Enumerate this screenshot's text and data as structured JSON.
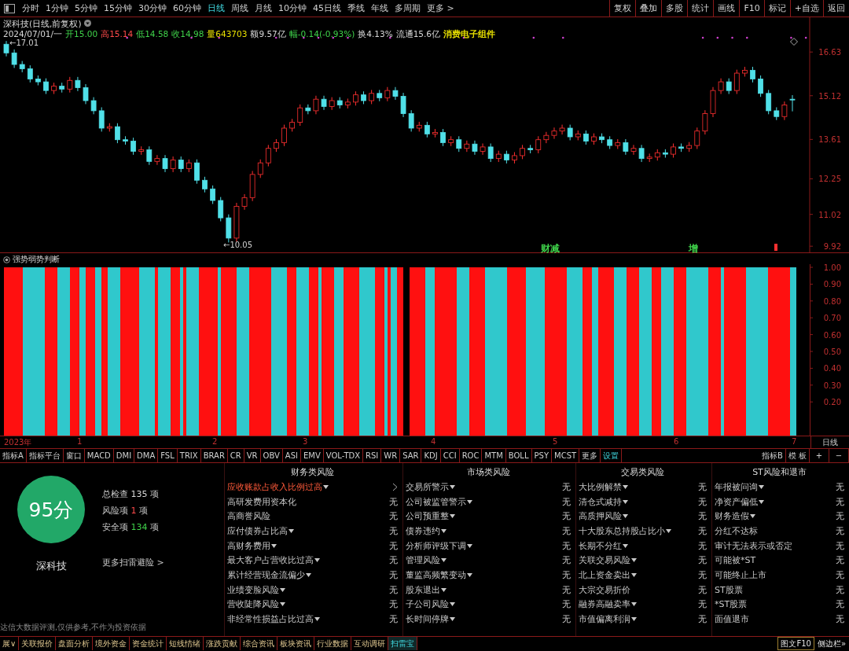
{
  "toolbar": {
    "periods": [
      {
        "label": "分时",
        "selected": false
      },
      {
        "label": "1分钟",
        "selected": false
      },
      {
        "label": "5分钟",
        "selected": false
      },
      {
        "label": "15分钟",
        "selected": false
      },
      {
        "label": "30分钟",
        "selected": false
      },
      {
        "label": "60分钟",
        "selected": false
      },
      {
        "label": "日线",
        "selected": true
      },
      {
        "label": "周线",
        "selected": false
      },
      {
        "label": "月线",
        "selected": false
      },
      {
        "label": "10分钟",
        "selected": false
      },
      {
        "label": "45日线",
        "selected": false
      },
      {
        "label": "季线",
        "selected": false
      },
      {
        "label": "年线",
        "selected": false
      },
      {
        "label": "多周期",
        "selected": false
      },
      {
        "label": "更多 >",
        "selected": false
      }
    ],
    "actions": [
      "复权",
      "叠加",
      "多股",
      "统计",
      "画线",
      "F10",
      "标记",
      "+自选",
      "返回"
    ]
  },
  "chart": {
    "title": "深科技(日线,前复权)",
    "quote": [
      {
        "text": "2024/07/01/一",
        "color": "#d8d8d8"
      },
      {
        "text": "开15.00",
        "color": "#3fd24a"
      },
      {
        "text": "高15.14",
        "color": "#ff4a4a"
      },
      {
        "text": "低14.58",
        "color": "#3fd24a"
      },
      {
        "text": "收14.98",
        "color": "#3fd24a"
      },
      {
        "text": "量643703",
        "color": "#e8e000"
      },
      {
        "text": "额9.57亿",
        "color": "#d8d8d8"
      },
      {
        "text": "幅-0.14(-0.93%)",
        "color": "#3fd24a"
      },
      {
        "text": "换4.13%",
        "color": "#d8d8d8"
      },
      {
        "text": "流通15.6亿",
        "color": "#d8d8d8"
      },
      {
        "text": "消费电子组件",
        "color": "#e8e000"
      }
    ],
    "high_label": "←17.01",
    "low_label": "←10.05",
    "chart_data": {
      "type": "candlestick",
      "ylim": [
        9.68,
        17.83
      ],
      "yticks": [
        16.63,
        15.12,
        13.61,
        12.25,
        11.02,
        9.92
      ],
      "ohlc": [
        [
          16.9,
          17.01,
          16.48,
          16.6
        ],
        [
          16.6,
          16.72,
          16.08,
          16.2
        ],
        [
          16.2,
          16.32,
          15.93,
          16.05
        ],
        [
          16.05,
          16.17,
          15.58,
          15.7
        ],
        [
          15.7,
          15.82,
          15.48,
          15.6
        ],
        [
          15.6,
          15.72,
          15.18,
          15.3
        ],
        [
          15.3,
          15.57,
          15.18,
          15.45
        ],
        [
          15.45,
          15.57,
          15.23,
          15.35
        ],
        [
          15.35,
          15.77,
          15.23,
          15.65
        ],
        [
          15.65,
          15.77,
          15.28,
          15.4
        ],
        [
          15.4,
          15.52,
          14.83,
          14.95
        ],
        [
          14.95,
          15.07,
          14.48,
          14.6
        ],
        [
          14.6,
          14.72,
          13.88,
          14.0
        ],
        [
          14.0,
          14.17,
          13.88,
          14.05
        ],
        [
          14.05,
          14.17,
          13.48,
          13.6
        ],
        [
          13.6,
          13.72,
          13.43,
          13.55
        ],
        [
          13.55,
          13.67,
          13.08,
          13.2
        ],
        [
          13.2,
          13.37,
          13.08,
          13.25
        ],
        [
          13.25,
          13.37,
          12.73,
          12.85
        ],
        [
          12.85,
          13.07,
          12.73,
          12.95
        ],
        [
          12.95,
          13.07,
          12.48,
          12.6
        ],
        [
          12.6,
          13.02,
          12.48,
          12.9
        ],
        [
          12.9,
          13.02,
          12.48,
          12.6
        ],
        [
          12.6,
          12.92,
          12.48,
          12.8
        ],
        [
          12.8,
          12.92,
          12.08,
          12.2
        ],
        [
          12.2,
          12.32,
          11.78,
          11.9
        ],
        [
          11.9,
          12.02,
          11.38,
          11.5
        ],
        [
          11.5,
          11.62,
          10.78,
          10.9
        ],
        [
          10.9,
          11.02,
          10.05,
          10.2
        ],
        [
          10.2,
          11.42,
          10.08,
          11.3
        ],
        [
          11.3,
          11.72,
          11.18,
          11.6
        ],
        [
          11.6,
          12.52,
          11.48,
          12.4
        ],
        [
          12.4,
          12.92,
          12.28,
          12.8
        ],
        [
          12.8,
          13.42,
          12.68,
          13.3
        ],
        [
          13.3,
          13.62,
          13.18,
          13.5
        ],
        [
          13.5,
          14.12,
          13.38,
          14.0
        ],
        [
          14.0,
          14.32,
          13.88,
          14.2
        ],
        [
          14.2,
          14.82,
          14.08,
          14.7
        ],
        [
          14.7,
          14.82,
          14.48,
          14.6
        ],
        [
          14.6,
          15.12,
          14.48,
          15.0
        ],
        [
          15.0,
          15.12,
          14.63,
          14.75
        ],
        [
          14.75,
          15.07,
          14.63,
          14.95
        ],
        [
          14.95,
          15.07,
          14.68,
          14.8
        ],
        [
          14.8,
          15.02,
          14.68,
          14.9
        ],
        [
          14.9,
          15.27,
          14.78,
          15.15
        ],
        [
          15.15,
          15.27,
          14.83,
          14.95
        ],
        [
          14.95,
          15.32,
          14.83,
          15.2
        ],
        [
          15.2,
          15.32,
          14.93,
          15.05
        ],
        [
          15.05,
          15.42,
          14.93,
          15.3
        ],
        [
          15.3,
          15.42,
          14.98,
          15.1
        ],
        [
          15.1,
          15.22,
          14.38,
          14.5
        ],
        [
          14.5,
          14.62,
          13.88,
          14.0
        ],
        [
          14.0,
          14.22,
          13.88,
          14.1
        ],
        [
          14.1,
          14.22,
          13.68,
          13.8
        ],
        [
          13.8,
          13.97,
          13.68,
          13.85
        ],
        [
          13.85,
          13.97,
          13.38,
          13.5
        ],
        [
          13.5,
          13.72,
          13.38,
          13.6
        ],
        [
          13.6,
          13.72,
          13.18,
          13.3
        ],
        [
          13.3,
          13.57,
          13.18,
          13.45
        ],
        [
          13.45,
          13.57,
          13.08,
          13.2
        ],
        [
          13.2,
          13.47,
          13.08,
          13.35
        ],
        [
          13.35,
          13.47,
          12.83,
          12.95
        ],
        [
          12.95,
          13.22,
          12.83,
          13.1
        ],
        [
          13.1,
          13.22,
          12.78,
          12.9
        ],
        [
          12.9,
          13.17,
          12.78,
          13.05
        ],
        [
          13.05,
          13.42,
          12.93,
          13.3
        ],
        [
          13.3,
          13.42,
          13.13,
          13.25
        ],
        [
          13.25,
          13.72,
          13.13,
          13.6
        ],
        [
          13.6,
          13.87,
          13.48,
          13.75
        ],
        [
          13.75,
          14.02,
          13.63,
          13.9
        ],
        [
          13.9,
          14.12,
          13.78,
          14.0
        ],
        [
          14.0,
          14.12,
          13.58,
          13.7
        ],
        [
          13.7,
          13.92,
          13.58,
          13.8
        ],
        [
          13.8,
          13.92,
          13.43,
          13.55
        ],
        [
          13.55,
          13.82,
          13.43,
          13.7
        ],
        [
          13.7,
          13.82,
          13.48,
          13.6
        ],
        [
          13.6,
          13.72,
          13.28,
          13.4
        ],
        [
          13.4,
          13.62,
          13.28,
          13.5
        ],
        [
          13.5,
          13.62,
          13.08,
          13.2
        ],
        [
          13.2,
          13.42,
          13.08,
          13.3
        ],
        [
          13.3,
          13.42,
          12.83,
          12.95
        ],
        [
          12.95,
          13.12,
          12.83,
          13.0
        ],
        [
          13.0,
          13.27,
          12.88,
          13.15
        ],
        [
          13.15,
          13.27,
          12.98,
          13.1
        ],
        [
          13.1,
          13.47,
          12.98,
          13.35
        ],
        [
          13.35,
          13.47,
          13.18,
          13.3
        ],
        [
          13.3,
          13.52,
          13.18,
          13.4
        ],
        [
          13.4,
          14.02,
          13.28,
          13.9
        ],
        [
          13.9,
          14.62,
          13.78,
          14.5
        ],
        [
          14.5,
          15.42,
          14.38,
          15.3
        ],
        [
          15.3,
          15.72,
          15.18,
          15.6
        ],
        [
          15.6,
          15.72,
          15.18,
          15.3
        ],
        [
          15.3,
          16.02,
          15.18,
          15.9
        ],
        [
          15.9,
          16.12,
          15.78,
          16.0
        ],
        [
          16.0,
          16.12,
          15.58,
          15.7
        ],
        [
          15.7,
          15.82,
          15.08,
          15.2
        ],
        [
          15.2,
          15.32,
          14.48,
          14.6
        ],
        [
          14.6,
          14.72,
          14.28,
          14.4
        ],
        [
          14.4,
          14.92,
          14.28,
          14.8
        ],
        [
          15.0,
          15.14,
          14.58,
          14.98
        ]
      ]
    },
    "events": [
      {
        "text": "财减",
        "color": "#3fd24a"
      },
      {
        "text": "增",
        "color": "#3fd24a"
      }
    ]
  },
  "indicator": {
    "title": "强势弱势判断",
    "y_ticks": [
      "1.00",
      "0.90",
      "0.80",
      "0.70",
      "0.60",
      "0.50",
      "0.40",
      "0.30",
      "0.20"
    ]
  },
  "x_axis": {
    "labels": [
      "2023年",
      "1",
      "2",
      "3",
      "4",
      "5",
      "6",
      "7"
    ],
    "period": "日线"
  },
  "indicator_tabs": {
    "items": [
      {
        "label": "指标A",
        "selected": false
      },
      {
        "label": "指标平台",
        "selected": false
      },
      {
        "label": "窗口",
        "selected": false
      },
      {
        "label": "MACD",
        "selected": false
      },
      {
        "label": "DMI",
        "selected": false
      },
      {
        "label": "DMA",
        "selected": false
      },
      {
        "label": "FSL",
        "selected": false
      },
      {
        "label": "TRIX",
        "selected": false
      },
      {
        "label": "BRAR",
        "selected": false
      },
      {
        "label": "CR",
        "selected": false
      },
      {
        "label": "VR",
        "selected": false
      },
      {
        "label": "OBV",
        "selected": false
      },
      {
        "label": "ASI",
        "selected": false
      },
      {
        "label": "EMV",
        "selected": false
      },
      {
        "label": "VOL-TDX",
        "selected": false
      },
      {
        "label": "RSI",
        "selected": false
      },
      {
        "label": "WR",
        "selected": false
      },
      {
        "label": "SAR",
        "selected": false
      },
      {
        "label": "KDJ",
        "selected": false
      },
      {
        "label": "CCI",
        "selected": false
      },
      {
        "label": "ROC",
        "selected": false
      },
      {
        "label": "MTM",
        "selected": false
      },
      {
        "label": "BOLL",
        "selected": false
      },
      {
        "label": "PSY",
        "selected": false
      },
      {
        "label": "MCST",
        "selected": false
      },
      {
        "label": "更多",
        "selected": false
      },
      {
        "label": "设置",
        "selected": true
      }
    ],
    "right": [
      "指标B",
      "模 板",
      "+",
      "−"
    ]
  },
  "risk": {
    "score": "95分",
    "stock": "深科技",
    "stats": [
      {
        "label": "总检查",
        "value": "135",
        "unit": "项",
        "color": "#d8d8d8"
      },
      {
        "label": "风险项",
        "value": "1",
        "unit": "项",
        "color": "#ff4a4a"
      },
      {
        "label": "安全项",
        "value": "134",
        "unit": "项",
        "color": "#3fd24a"
      }
    ],
    "more_link": "更多扫雷避险 >",
    "disclaimer": "达信大数据评测,仅供参考,不作为投资依据",
    "categories": [
      {
        "title": "财务类风险",
        "items": [
          {
            "label": "应收账款占收入比例过高",
            "dropdown": true,
            "alert": true
          },
          {
            "label": "高研发费用资本化",
            "dropdown": false,
            "alert": false,
            "result": "无"
          },
          {
            "label": "高商誉风险",
            "dropdown": false,
            "alert": false,
            "result": "无"
          },
          {
            "label": "应付债券占比高",
            "dropdown": true,
            "alert": false,
            "result": "无"
          },
          {
            "label": "高财务费用",
            "dropdown": true,
            "alert": false,
            "result": "无"
          },
          {
            "label": "最大客户占营收比过高",
            "dropdown": true,
            "alert": false,
            "result": "无"
          },
          {
            "label": "累计经营现金流偏少",
            "dropdown": true,
            "alert": false,
            "result": "无"
          },
          {
            "label": "业绩变脸风险",
            "dropdown": true,
            "alert": false,
            "result": "无"
          },
          {
            "label": "营收陡降风险",
            "dropdown": true,
            "alert": false,
            "result": "无"
          },
          {
            "label": "非经常性损益占比过高",
            "dropdown": true,
            "alert": false,
            "result": "无"
          }
        ]
      },
      {
        "title": "市场类风险",
        "items": [
          {
            "label": "交易所警示",
            "dropdown": true,
            "alert": false,
            "result": "无"
          },
          {
            "label": "公司被监管警示",
            "dropdown": true,
            "alert": false,
            "result": "无"
          },
          {
            "label": "公司预重整",
            "dropdown": true,
            "alert": false,
            "result": "无"
          },
          {
            "label": "债券违约",
            "dropdown": true,
            "alert": false,
            "result": "无"
          },
          {
            "label": "分析师评级下调",
            "dropdown": true,
            "alert": false,
            "result": "无"
          },
          {
            "label": "管理风险",
            "dropdown": true,
            "alert": false,
            "result": "无"
          },
          {
            "label": "董监高频繁变动",
            "dropdown": true,
            "alert": false,
            "result": "无"
          },
          {
            "label": "股东退出",
            "dropdown": true,
            "alert": false,
            "result": "无"
          },
          {
            "label": "子公司风险",
            "dropdown": true,
            "alert": false,
            "result": "无"
          },
          {
            "label": "长时间停牌",
            "dropdown": true,
            "alert": false,
            "result": "无"
          }
        ]
      },
      {
        "title": "交易类风险",
        "items": [
          {
            "label": "大比例解禁",
            "dropdown": true,
            "alert": false,
            "result": "无"
          },
          {
            "label": "清仓式减持",
            "dropdown": true,
            "alert": false,
            "result": "无"
          },
          {
            "label": "高质押风险",
            "dropdown": true,
            "alert": false,
            "result": "无"
          },
          {
            "label": "十大股东总持股占比小",
            "dropdown": true,
            "alert": false,
            "result": "无"
          },
          {
            "label": "长期不分红",
            "dropdown": true,
            "alert": false,
            "result": "无"
          },
          {
            "label": "关联交易风险",
            "dropdown": true,
            "alert": false,
            "result": "无"
          },
          {
            "label": "北上资金卖出",
            "dropdown": true,
            "alert": false,
            "result": "无"
          },
          {
            "label": "大宗交易折价",
            "dropdown": false,
            "alert": false,
            "result": "无"
          },
          {
            "label": "融券高融卖率",
            "dropdown": true,
            "alert": false,
            "result": "无"
          },
          {
            "label": "市值偏离利润",
            "dropdown": true,
            "alert": false,
            "result": "无"
          }
        ]
      },
      {
        "title": "ST风险和退市",
        "items": [
          {
            "label": "年报被问询",
            "dropdown": true,
            "alert": false,
            "result": "无"
          },
          {
            "label": "净资产偏低",
            "dropdown": true,
            "alert": false,
            "result": "无"
          },
          {
            "label": "财务造假",
            "dropdown": true,
            "alert": false,
            "result": "无"
          },
          {
            "label": "分红不达标",
            "dropdown": false,
            "alert": false,
            "result": "无"
          },
          {
            "label": "审计无法表示或否定",
            "dropdown": false,
            "alert": false,
            "result": "无"
          },
          {
            "label": "可能被*ST",
            "dropdown": false,
            "alert": false,
            "result": "无"
          },
          {
            "label": "可能终止上市",
            "dropdown": false,
            "alert": false,
            "result": "无"
          },
          {
            "label": "ST股票",
            "dropdown": false,
            "alert": false,
            "result": "无"
          },
          {
            "label": "*ST股票",
            "dropdown": false,
            "alert": false,
            "result": "无"
          },
          {
            "label": "面值退市",
            "dropdown": false,
            "alert": false,
            "result": "无"
          }
        ]
      }
    ]
  },
  "bottom_bar": {
    "tabs": [
      {
        "label": "展∨",
        "selected": false
      },
      {
        "label": "关联报价",
        "selected": false
      },
      {
        "label": "盘面分析",
        "selected": false
      },
      {
        "label": "境外资金",
        "selected": false
      },
      {
        "label": "资金统计",
        "selected": false
      },
      {
        "label": "短线情绪",
        "selected": false
      },
      {
        "label": "涨跌贡献",
        "selected": false
      },
      {
        "label": "综合资讯",
        "selected": false
      },
      {
        "label": "板块资讯",
        "selected": false
      },
      {
        "label": "行业数据",
        "selected": false
      },
      {
        "label": "互动调研",
        "selected": false
      },
      {
        "label": "扫雷宝",
        "selected": true
      }
    ],
    "right": [
      "图文F10",
      "侧边栏»"
    ]
  }
}
